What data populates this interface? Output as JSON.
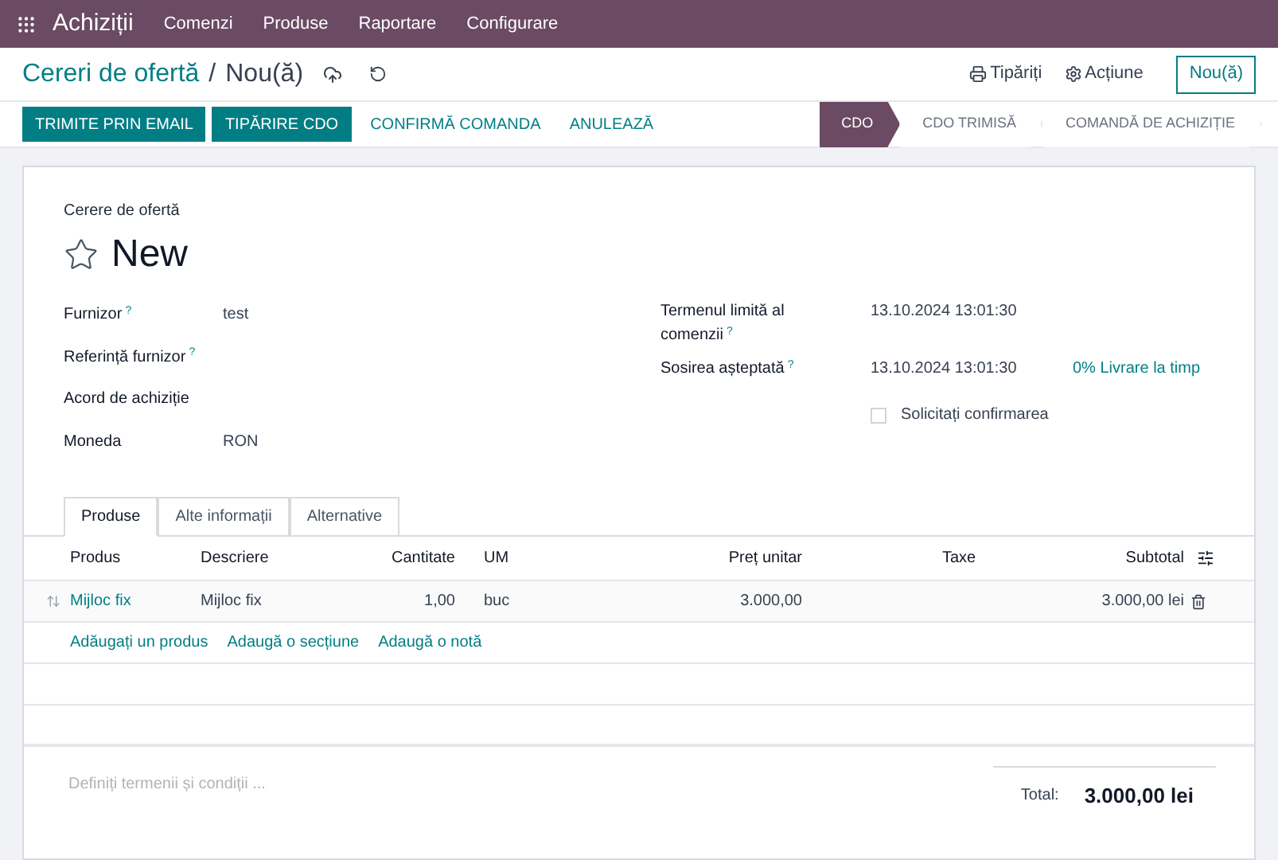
{
  "navbar": {
    "app": "Achiziții",
    "menu": [
      "Comenzi",
      "Produse",
      "Raportare",
      "Configurare"
    ]
  },
  "breadcrumb": {
    "parent": "Cereri de ofertă",
    "separator": "/",
    "current": "Nou(ă)"
  },
  "top_actions": {
    "print": "Tipăriți",
    "action": "Acțiune",
    "new_button": "Nou(ă)"
  },
  "buttons": [
    {
      "label": "TRIMITE PRIN EMAIL",
      "kind": "primary"
    },
    {
      "label": "TIPĂRIRE CDO",
      "kind": "primary"
    },
    {
      "label": "CONFIRMĂ COMANDA",
      "kind": "link"
    },
    {
      "label": "ANULEAZĂ",
      "kind": "link"
    }
  ],
  "stages": [
    {
      "label": "CDO",
      "selected": true
    },
    {
      "label": "CDO TRIMISĂ",
      "selected": false
    },
    {
      "label": "COMANDĂ DE ACHIZIȚIE",
      "selected": false
    }
  ],
  "form": {
    "subtitle": "Cerere de ofertă",
    "title": "New",
    "starred": false,
    "left_fields": [
      {
        "label": "Furnizor",
        "help": "?",
        "value": "test"
      },
      {
        "label": "Referință furnizor",
        "help": "?"
      },
      {
        "label": "Acord de achiziție"
      },
      {
        "label": "Moneda",
        "value": "RON"
      }
    ],
    "right_fields": [
      {
        "label": "Termenul limită al comenzii",
        "help": "?",
        "value": "13.10.2024 13:01:30"
      },
      {
        "label": "Sosirea așteptată",
        "help": "?",
        "value": "13.10.2024 13:01:30",
        "link": "0% Livrare la timp"
      }
    ],
    "ask_confirmation": {
      "label": "Solicitați confirmarea",
      "checked": false
    }
  },
  "tabs": [
    {
      "label": "Produse",
      "selected": true
    },
    {
      "label": "Alte informații",
      "selected": false
    },
    {
      "label": "Alternative",
      "selected": false
    }
  ],
  "table": {
    "columns": [
      "Produs",
      "Descriere",
      "Cantitate",
      "UM",
      "Preț unitar",
      "Taxe",
      "Subtotal"
    ],
    "rows": [
      [
        "Mijloc fix",
        "Mijloc fix",
        "1,00",
        "buc",
        "3.000,00",
        "",
        "3.000,00 lei"
      ]
    ],
    "add_links": [
      "Adăugați un produs",
      "Adaugă o secțiune",
      "Adaugă o notă"
    ]
  },
  "terms": {
    "placeholder": "Definiți termenii și condiții ..."
  },
  "total": {
    "label": "Total:",
    "value": "3.000,00 lei"
  }
}
